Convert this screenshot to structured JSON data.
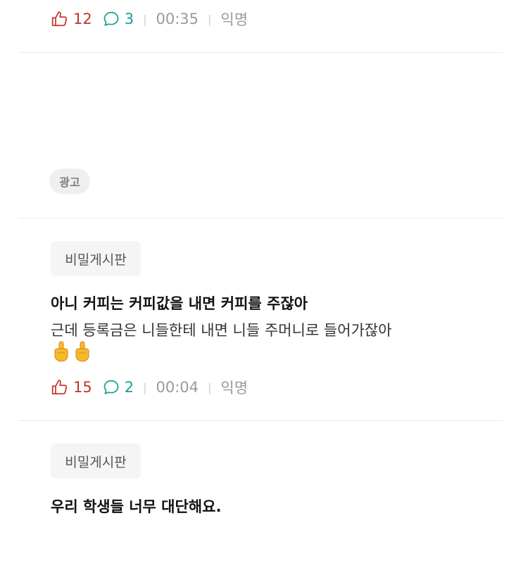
{
  "colors": {
    "like": "#c2352a",
    "comment": "#1a9d95",
    "muted": "#9a9a9a"
  },
  "posts": [
    {
      "likes": "12",
      "comments": "3",
      "time": "00:35",
      "author": "익명"
    },
    {
      "ad_label": "광고"
    },
    {
      "board": "비밀게시판",
      "title": "아니 커피는 커피값을 내면 커피를 주잖아",
      "body": "근데 등록금은 니들한테 내면 니들 주머니로 들어가잖아",
      "emoji": [
        "middle-finger-emoji",
        "middle-finger-emoji"
      ],
      "likes": "15",
      "comments": "2",
      "time": "00:04",
      "author": "익명"
    },
    {
      "board": "비밀게시판",
      "title": "우리 학생들 너무 대단해요."
    }
  ]
}
